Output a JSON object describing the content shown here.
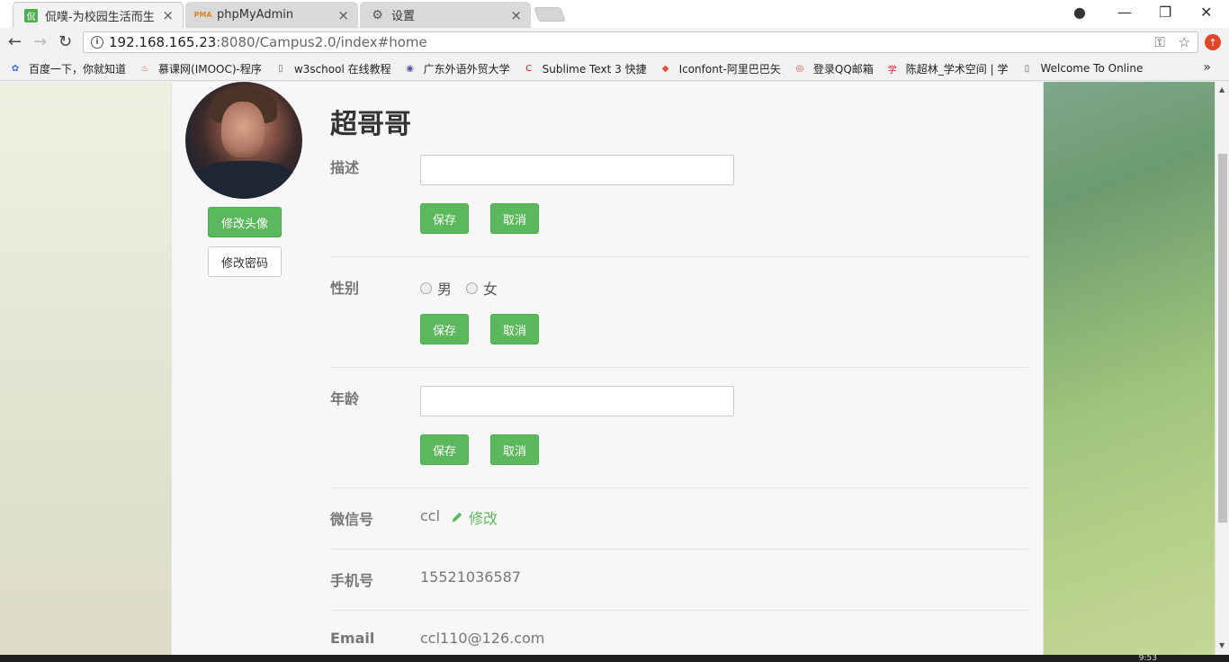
{
  "browser": {
    "tabs": [
      {
        "title": "侃噗-为校园生活而生",
        "icon": "campus-favicon",
        "active": true
      },
      {
        "title": "phpMyAdmin",
        "icon": "phpmyadmin-favicon",
        "active": false
      },
      {
        "title": "设置",
        "icon": "gear-icon",
        "active": false
      }
    ],
    "tab_close": "×",
    "window_controls": {
      "profile": "●",
      "minimize": "—",
      "restore": "❐",
      "close": "✕"
    },
    "nav": {
      "back": "←",
      "forward": "→",
      "reload": "↻"
    },
    "url": {
      "host": "192.168.165.23",
      "rest": ":8080/Campus2.0/index#home"
    },
    "omnibox_icons": {
      "info": "i",
      "key": "⚿",
      "star": "☆"
    },
    "extension_badge": "↑",
    "bookmarks": [
      {
        "label": "百度一下，你就知道",
        "icon": "paw-icon",
        "color": "#3b6fd8"
      },
      {
        "label": "慕课网(IMOOC)-程序",
        "icon": "flame-icon",
        "color": "#e04a2f"
      },
      {
        "label": "w3school 在线教程",
        "icon": "page-icon",
        "color": "#666666"
      },
      {
        "label": "广东外语外贸大学",
        "icon": "seal-icon",
        "color": "#4a5a9a"
      },
      {
        "label": "Sublime Text 3 快捷",
        "icon": "c-logo-icon",
        "color": "#d9231b"
      },
      {
        "label": "Iconfont-阿里巴巴矢",
        "icon": "iconfont-icon",
        "color": "#e5502c"
      },
      {
        "label": "登录QQ邮箱",
        "icon": "chrome-icon",
        "color": "#dd4b39"
      },
      {
        "label": "陈超林_学术空间 | 学",
        "icon": "scholar-icon",
        "color": "#d81e2a"
      },
      {
        "label": "Welcome To Online",
        "icon": "page-icon",
        "color": "#666666"
      }
    ],
    "bookmarks_more": "»"
  },
  "profile": {
    "username": "超哥哥",
    "change_avatar_label": "修改头像",
    "change_password_label": "修改密码",
    "save_label": "保存",
    "cancel_label": "取消",
    "fields": {
      "description": {
        "label": "描述",
        "value": ""
      },
      "gender": {
        "label": "性别",
        "options": [
          "男",
          "女"
        ]
      },
      "age": {
        "label": "年龄",
        "value": ""
      },
      "wechat": {
        "label": "微信号",
        "value": "ccl",
        "edit_label": "修改"
      },
      "phone": {
        "label": "手机号",
        "value": "15521036587"
      },
      "email": {
        "label": "Email",
        "value": "ccl110@126.com"
      }
    }
  },
  "taskbar": {
    "clock": "9:53"
  },
  "colors": {
    "accent_green": "#5cb85c",
    "panel_bg": "#f7f7f7"
  }
}
